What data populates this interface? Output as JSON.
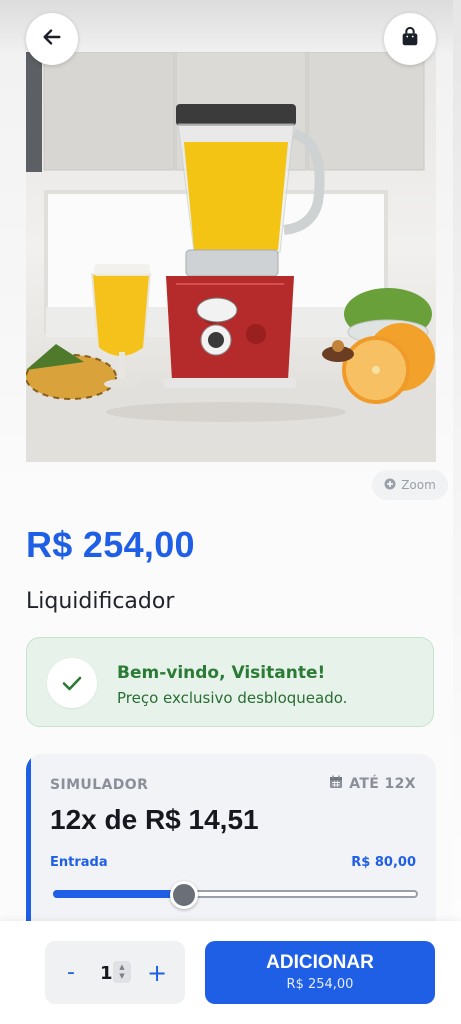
{
  "header": {
    "back_icon": "arrow-left-icon",
    "bag_icon": "shopping-bag-icon"
  },
  "product_image": {
    "zoom_label": "Zoom",
    "zoom_icon": "plus-circle-icon"
  },
  "product": {
    "price": "R$ 254,00",
    "name": "Liquidificador"
  },
  "welcome": {
    "title": "Bem-vindo, Visitante!",
    "subtitle": "Preço exclusivo desbloqueado.",
    "icon": "check-icon"
  },
  "simulator": {
    "label": "SIMULADOR",
    "up_to": "ATÉ 12X",
    "calendar_icon": "calendar-icon",
    "installment": "12x de R$ 14,51",
    "entrada_label": "Entrada",
    "entrada_value": "R$ 80,00",
    "slider_fraction": 0.36
  },
  "cart": {
    "minus": "-",
    "plus": "+",
    "quantity": "1",
    "add_label": "ADICIONAR",
    "add_price": "R$ 254,00"
  },
  "colors": {
    "accent": "#1f5fe6",
    "success": "#2b7a35",
    "success_bg": "#e7f3ea",
    "blender_red": "#b52a2a",
    "juice": "#f4c21a"
  }
}
